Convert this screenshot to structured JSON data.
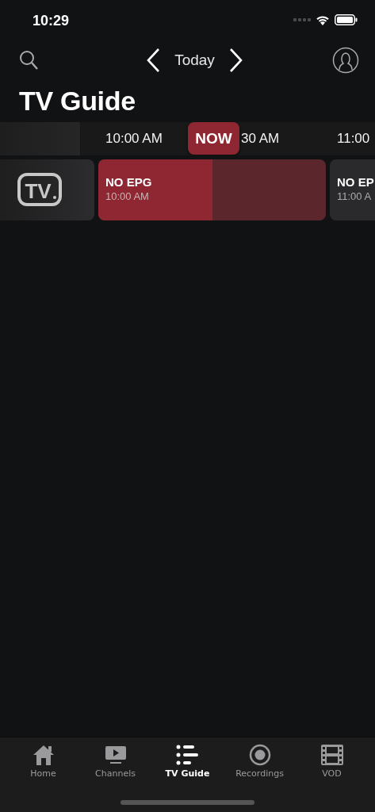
{
  "status_bar": {
    "time": "10:29"
  },
  "header": {
    "date_label": "Today"
  },
  "title": "TV Guide",
  "timeline": {
    "labels": [
      "10:00 AM",
      "30 AM",
      "11:00"
    ],
    "now_badge": "NOW"
  },
  "channels": [
    {
      "logo_text": "TV",
      "programs": [
        {
          "title": "NO EPG",
          "time": "10:00 AM",
          "live": true,
          "level": 0.5
        },
        {
          "title": "NO EP",
          "time": "11:00 A",
          "live": false
        }
      ]
    }
  ],
  "tab_bar": [
    {
      "label": "Home",
      "selected": false
    },
    {
      "label": "Channels",
      "selected": false
    },
    {
      "label": "TV Guide",
      "selected": true
    },
    {
      "label": "Recordings",
      "selected": false
    },
    {
      "label": "VOD",
      "selected": false
    }
  ]
}
